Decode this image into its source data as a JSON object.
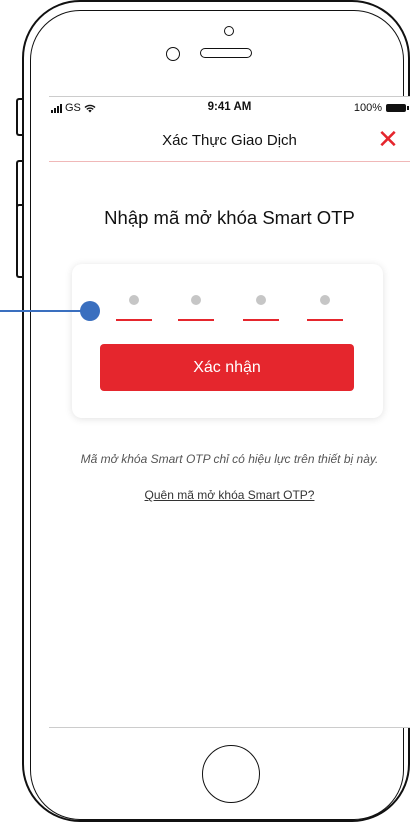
{
  "status_bar": {
    "carrier": "GS",
    "time": "9:41 AM",
    "battery": "100%"
  },
  "nav": {
    "title": "Xác Thực Giao Dịch",
    "close_icon": "close-icon"
  },
  "main": {
    "heading": "Nhập mã mở khóa Smart OTP",
    "pin_length": 4,
    "pin_entered": 0,
    "confirm_label": "Xác nhận",
    "info_text": "Mã mở khóa Smart OTP chỉ có hiệu lực trên thiết bị này.",
    "forgot_link": "Quên mã mở khóa Smart OTP?"
  },
  "colors": {
    "accent": "#e5262d",
    "annotation": "#3a6fbf"
  }
}
